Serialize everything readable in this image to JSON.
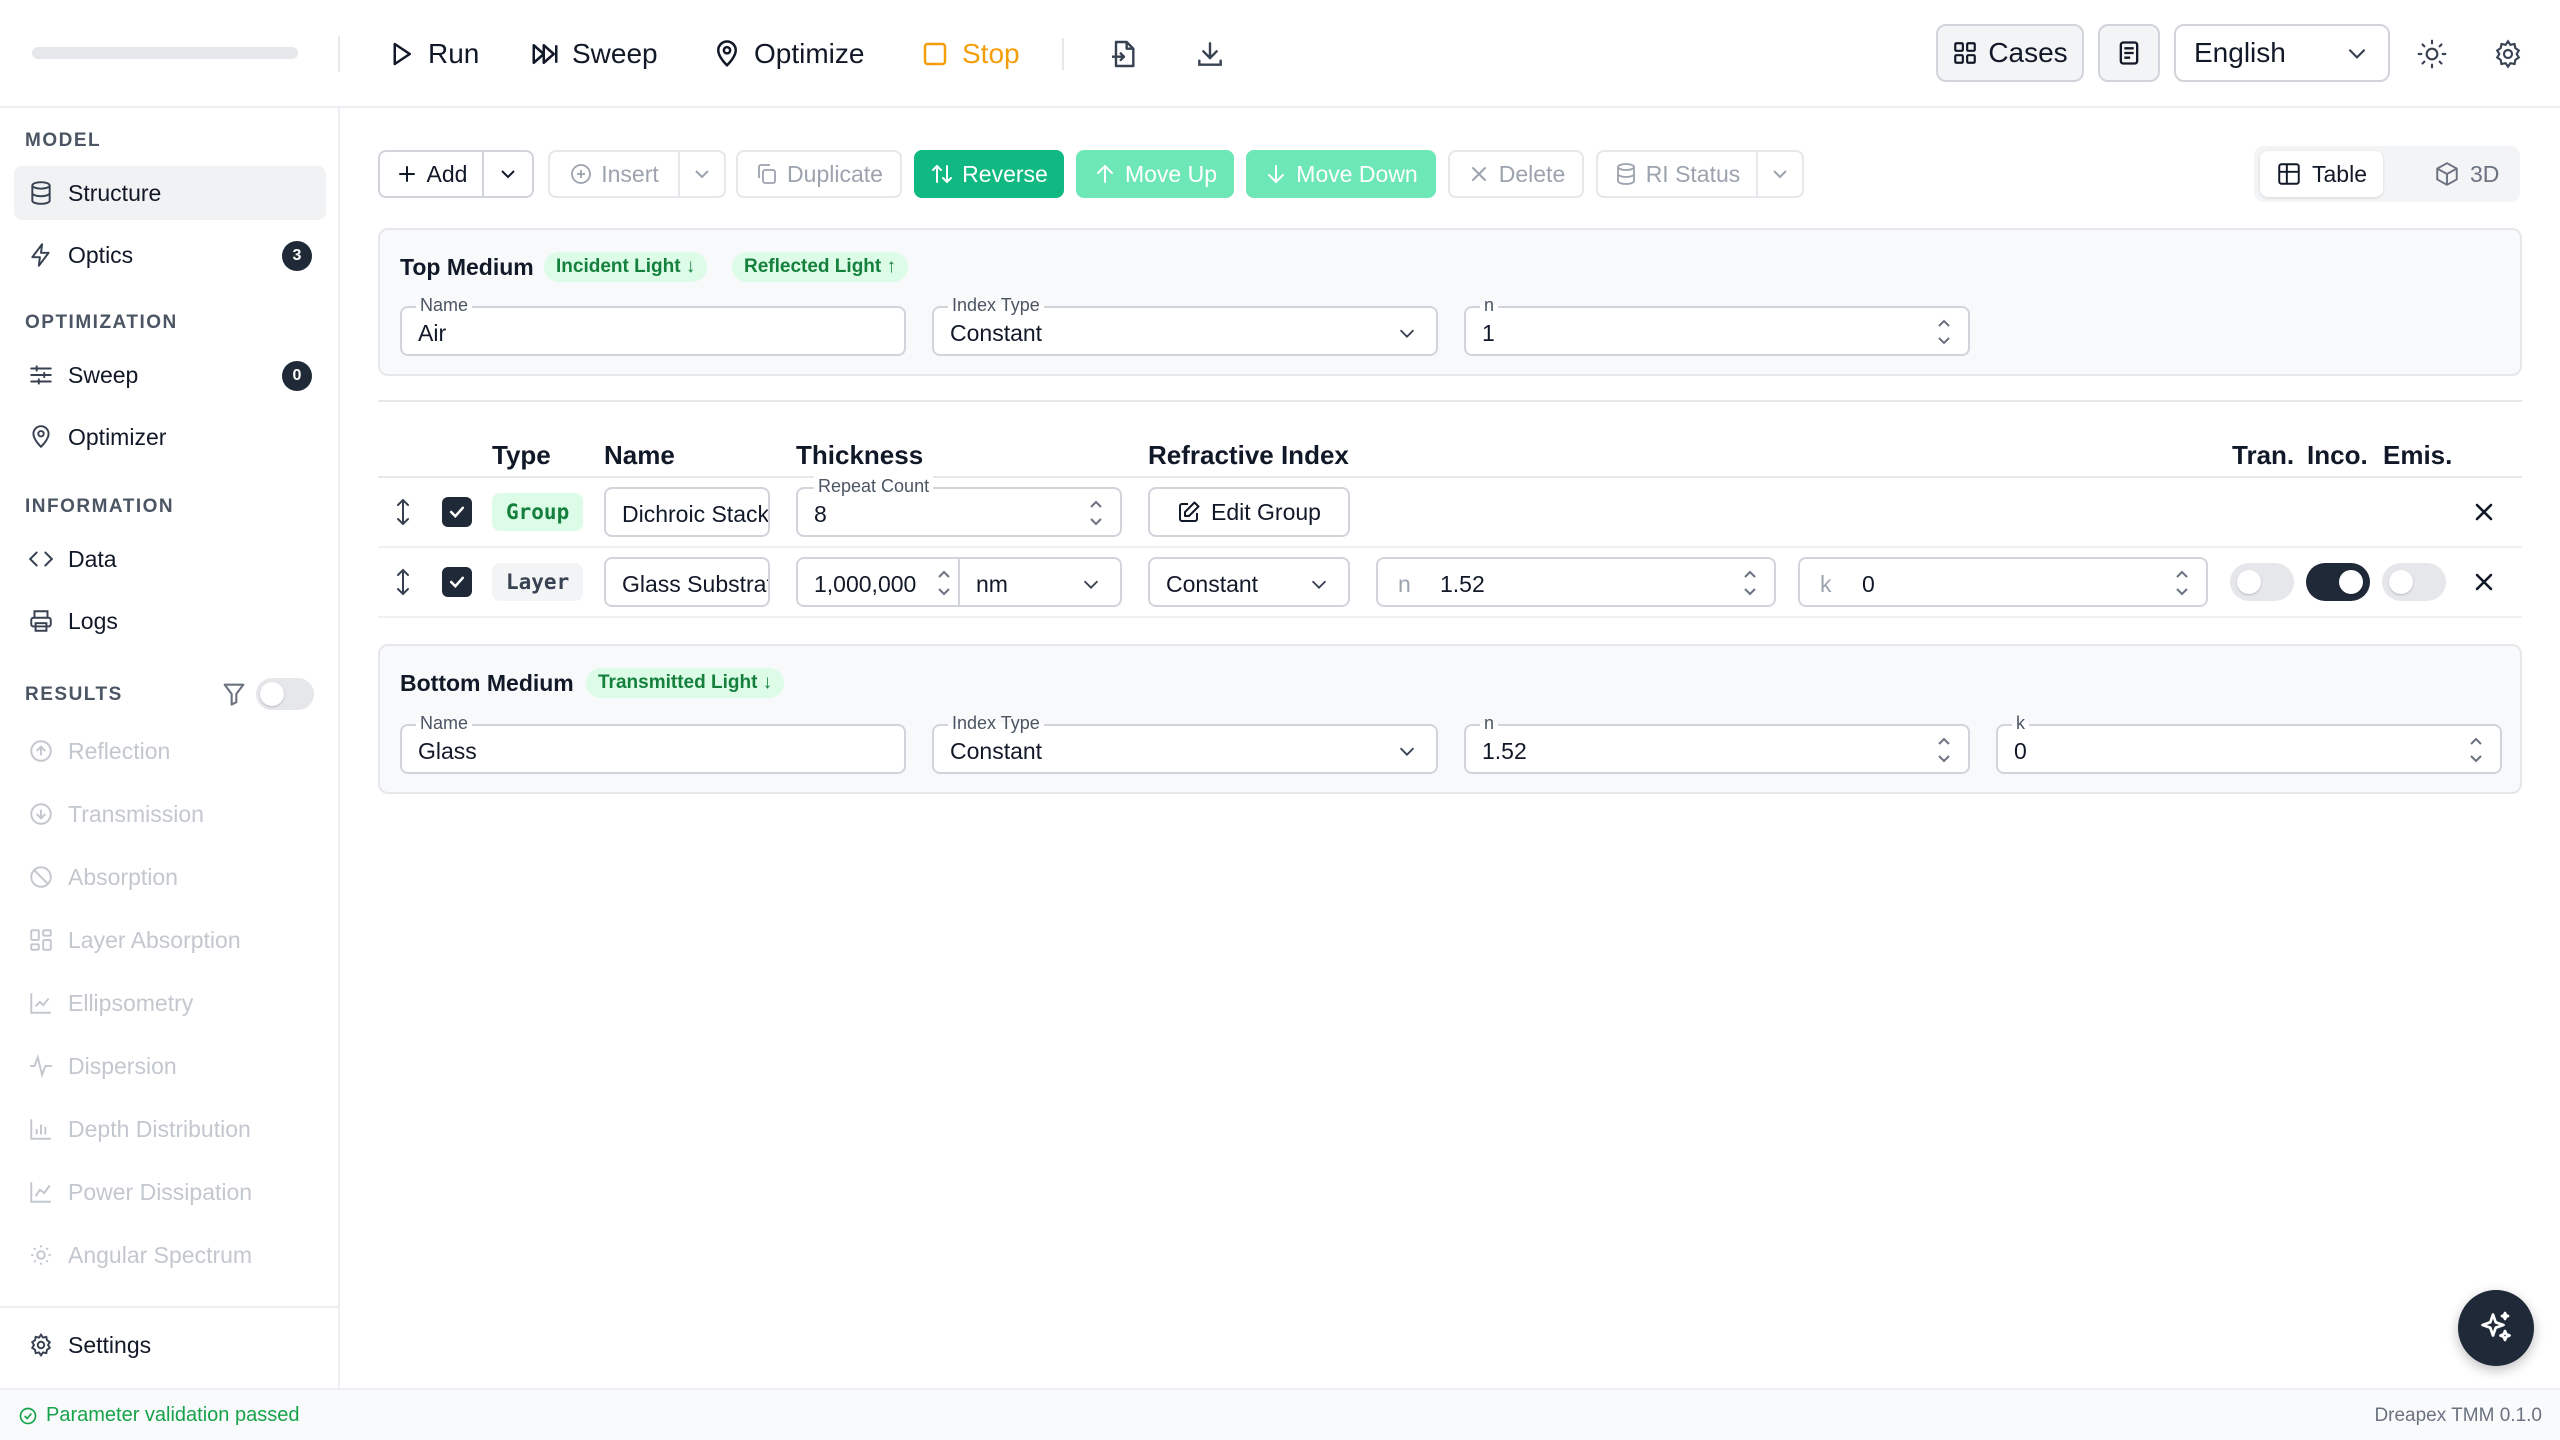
{
  "toolbar": {
    "progress": 0,
    "run": "Run",
    "sweep": "Sweep",
    "optimize": "Optimize",
    "stop": "Stop",
    "cases": "Cases",
    "language": "English",
    "stop_color": "#f59e0b"
  },
  "sidebar": {
    "sections": {
      "model": "MODEL",
      "optimization": "OPTIMIZATION",
      "information": "INFORMATION",
      "results": "RESULTS"
    },
    "model_items": [
      {
        "label": "Structure",
        "icon": "database-icon",
        "active": true
      },
      {
        "label": "Optics",
        "icon": "zap-icon",
        "badge": "3"
      }
    ],
    "optimization_items": [
      {
        "label": "Sweep",
        "icon": "sliders-icon",
        "badge": "0"
      },
      {
        "label": "Optimizer",
        "icon": "map-pin-icon"
      }
    ],
    "information_items": [
      {
        "label": "Data",
        "icon": "code-icon"
      },
      {
        "label": "Logs",
        "icon": "printer-icon"
      }
    ],
    "results_items": [
      {
        "label": "Reflection",
        "icon": "arrow-up-circle-icon"
      },
      {
        "label": "Transmission",
        "icon": "arrow-down-circle-icon"
      },
      {
        "label": "Absorption",
        "icon": "ban-icon"
      },
      {
        "label": "Layer Absorption",
        "icon": "grid-icon"
      },
      {
        "label": "Ellipsometry",
        "icon": "chart-icon"
      },
      {
        "label": "Dispersion",
        "icon": "activity-icon"
      },
      {
        "label": "Depth Distribution",
        "icon": "bar-chart-icon"
      },
      {
        "label": "Power Dissipation",
        "icon": "line-chart-icon"
      },
      {
        "label": "Angular Spectrum",
        "icon": "sun-icon"
      }
    ],
    "settings": "Settings"
  },
  "actions": {
    "add": "Add",
    "insert": "Insert",
    "duplicate": "Duplicate",
    "reverse": "Reverse",
    "move_up": "Move Up",
    "move_down": "Move Down",
    "delete": "Delete",
    "ri_status": "RI Status"
  },
  "view": {
    "table": "Table",
    "three_d": "3D",
    "selected": "Table"
  },
  "top_medium": {
    "title": "Top Medium",
    "chips": [
      "Incident Light ↓",
      "Reflected Light ↑"
    ],
    "name_label": "Name",
    "name": "Air",
    "index_type_label": "Index Type",
    "index_type": "Constant",
    "n_label": "n",
    "n": "1"
  },
  "table": {
    "headers": {
      "type": "Type",
      "name": "Name",
      "thickness": "Thickness",
      "refractive_index": "Refractive Index",
      "tran": "Tran.",
      "inco": "Inco.",
      "emis": "Emis."
    },
    "rows": [
      {
        "type": "Group",
        "checked": true,
        "name": "Dichroic Stack",
        "repeat_count_label": "Repeat Count",
        "repeat_count": "8",
        "action": "Edit Group"
      },
      {
        "type": "Layer",
        "checked": true,
        "name": "Glass Substrate",
        "thickness": "1,000,000",
        "unit": "nm",
        "index_type": "Constant",
        "n_prefix": "n",
        "n": "1.52",
        "k_prefix": "k",
        "k": "0",
        "tran": false,
        "inco": true,
        "emis": false
      }
    ]
  },
  "bottom_medium": {
    "title": "Bottom Medium",
    "chips": [
      "Transmitted Light ↓"
    ],
    "name_label": "Name",
    "name": "Glass",
    "index_type_label": "Index Type",
    "index_type": "Constant",
    "n_label": "n",
    "n": "1.52",
    "k_label": "k",
    "k": "0"
  },
  "status": {
    "message": "Parameter validation passed",
    "version": "Dreapex TMM 0.1.0"
  },
  "colors": {
    "accent_green": "#10b981",
    "accent_green_light": "#6ee7b7",
    "chip_bg": "#dcfce7",
    "chip_text": "#15803d",
    "dark": "#1f2937"
  }
}
